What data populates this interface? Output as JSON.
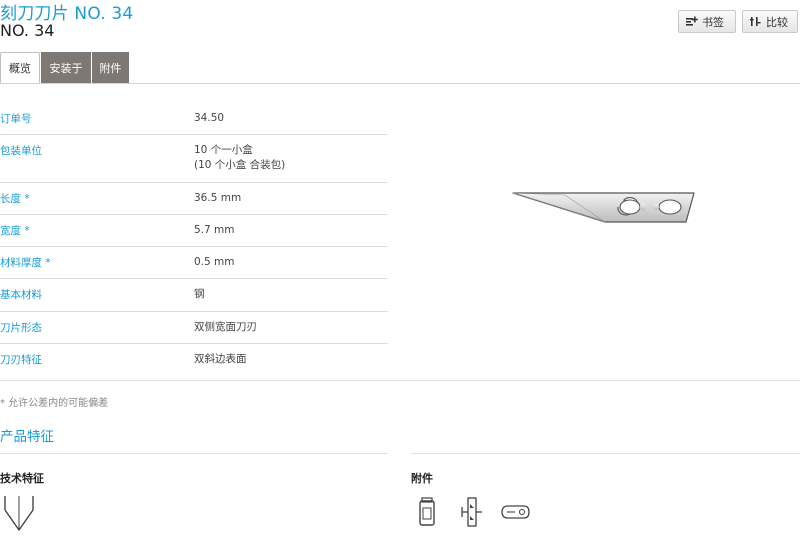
{
  "header": {
    "title": "刻刀刀片 NO. 34",
    "subtitle": "NO. 34",
    "bookmark_label": "书签",
    "compare_label": "比较"
  },
  "tabs": [
    {
      "label": "概览",
      "active": true
    },
    {
      "label": "安装于",
      "active": false
    },
    {
      "label": "附件",
      "active": false
    }
  ],
  "specs": [
    {
      "label": "订单号",
      "value": "34.50"
    },
    {
      "label": "包装单位",
      "value": "10 个一小盒",
      "value2": "(10 个小盒 合装包)"
    },
    {
      "label": "长度 *",
      "value": "36.5 mm"
    },
    {
      "label": "宽度 *",
      "value": "5.7 mm"
    },
    {
      "label": "材料厚度 *",
      "value": "0.5 mm"
    },
    {
      "label": "基本材料",
      "value": "钢"
    },
    {
      "label": "刀片形态",
      "value": "双侧宽面刀刃"
    },
    {
      "label": "刀刃特征",
      "value": "双斜边表面"
    }
  ],
  "note": "* 允许公差内的可能偏差",
  "features": {
    "title": "产品特征",
    "technical_heading": "技术特征",
    "accessories_heading": "附件"
  },
  "icons": [
    "bookmark-add-icon",
    "compare-icon",
    "blade-image",
    "double-bevel-icon",
    "box-icon",
    "mounting-icon",
    "blade-slot-icon"
  ],
  "colors": {
    "accent": "#1a9bd7",
    "tab_dark": "#7d7873"
  }
}
